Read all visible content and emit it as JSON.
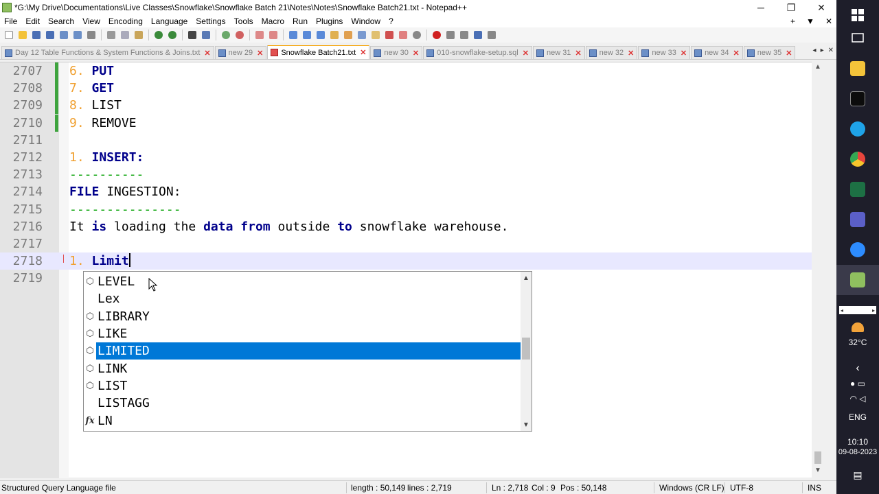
{
  "window": {
    "title": "*G:\\My Drive\\Documentations\\Live Classes\\Snowflake\\Snowflake Batch 21\\Notes\\Notes\\Snowflake Batch21.txt - Notepad++",
    "minimize": "─",
    "restore": "❐",
    "close": "✕"
  },
  "menu": {
    "items": [
      "File",
      "Edit",
      "Search",
      "View",
      "Encoding",
      "Language",
      "Settings",
      "Tools",
      "Macro",
      "Run",
      "Plugins",
      "Window",
      "?"
    ],
    "right": [
      "+",
      "▼",
      "✕"
    ]
  },
  "tabs": [
    {
      "label": "Day 12 Table Functions & System Functions & Joins.txt",
      "active": false
    },
    {
      "label": "new 29",
      "active": false
    },
    {
      "label": "Snowflake Batch21.txt",
      "active": true
    },
    {
      "label": "new 30",
      "active": false
    },
    {
      "label": "010-snowflake-setup.sql",
      "active": false
    },
    {
      "label": "new 31",
      "active": false
    },
    {
      "label": "new 32",
      "active": false
    },
    {
      "label": "new 33",
      "active": false
    },
    {
      "label": "new 34",
      "active": false
    },
    {
      "label": "new 35",
      "active": false
    }
  ],
  "tab_close_glyph": "✕",
  "tab_nav": [
    "◂",
    "▸",
    "✕"
  ],
  "editor": {
    "lines": [
      {
        "n": "2707",
        "num": "6.",
        "word": "PUT",
        "style": "kw"
      },
      {
        "n": "2708",
        "num": "7.",
        "word": "GET",
        "style": "kw"
      },
      {
        "n": "2709",
        "num": "8.",
        "word": "LIST",
        "style": "txt"
      },
      {
        "n": "2710",
        "num": "9.",
        "word": "REMOVE",
        "style": "txt"
      },
      {
        "n": "2711",
        "num": "",
        "word": "",
        "style": "txt"
      },
      {
        "n": "2712",
        "num": "1.",
        "word": "INSERT:",
        "style": "kw"
      },
      {
        "n": "2713",
        "num": "",
        "word": "----------",
        "style": "dash"
      },
      {
        "n": "2714",
        "num": "",
        "word": "FILE INGESTION:",
        "style": "mixed"
      },
      {
        "n": "2715",
        "num": "",
        "word": "---------------",
        "style": "dash"
      },
      {
        "n": "2716",
        "num": "",
        "word": "It is loading the data from outside to snowflake warehouse.",
        "style": "mixed"
      },
      {
        "n": "2717",
        "num": "",
        "word": "",
        "style": "txt"
      },
      {
        "n": "2718",
        "num": "1.",
        "word": "Limit",
        "style": "kw"
      },
      {
        "n": "2719",
        "num": "",
        "word": "",
        "style": "txt"
      }
    ],
    "line_2714": {
      "kw": "FILE",
      "rest": " INGESTION:"
    },
    "line_2716": [
      {
        "t": "It ",
        "k": false
      },
      {
        "t": "is",
        "k": true
      },
      {
        "t": " loading the ",
        "k": false
      },
      {
        "t": "data",
        "k": true
      },
      {
        "t": " ",
        "k": false
      },
      {
        "t": "from",
        "k": true
      },
      {
        "t": " outside ",
        "k": false
      },
      {
        "t": "to",
        "k": true
      },
      {
        "t": " snowflake warehouse.",
        "k": false
      }
    ]
  },
  "autocomplete": {
    "items": [
      {
        "label": "LEVEL",
        "icon": "⬡",
        "icon_name": "keyword-cube-icon"
      },
      {
        "label": "Lex",
        "icon": "",
        "icon_name": ""
      },
      {
        "label": "LIBRARY",
        "icon": "⬡",
        "icon_name": "keyword-cube-icon"
      },
      {
        "label": "LIKE",
        "icon": "⬡",
        "icon_name": "keyword-cube-icon"
      },
      {
        "label": "LIMITED",
        "icon": "⬡",
        "icon_name": "keyword-cube-icon",
        "selected": true
      },
      {
        "label": "LINK",
        "icon": "⬡",
        "icon_name": "keyword-cube-icon"
      },
      {
        "label": "LIST",
        "icon": "⬡",
        "icon_name": "keyword-cube-icon"
      },
      {
        "label": "LISTAGG",
        "icon": "",
        "icon_name": ""
      },
      {
        "label": "LN",
        "icon": "fx",
        "icon_name": "function-icon"
      }
    ],
    "scroll_up": "▲",
    "scroll_down": "▼"
  },
  "statusbar": {
    "filetype": "Structured Query Language file",
    "length": "length : 50,149",
    "lines": "lines : 2,719",
    "ln": "Ln : 2,718",
    "col": "Col : 9",
    "pos": "Pos : 50,148",
    "eol": "Windows (CR LF)",
    "encoding": "UTF-8",
    "mode": "INS"
  },
  "taskbar": {
    "temperature": "32°C",
    "language": "ENG",
    "time": "10:10",
    "date": "09-08-2023",
    "colors": {
      "windows": "#ffffff",
      "explorer": "#f3c33a",
      "terminal": "#0c0c0c",
      "edge": "#1fa3e8",
      "chrome": "#e8453c",
      "excel": "#1d7044",
      "teams": "#5b5fc7",
      "zoom": "#2d8cff",
      "notepadpp": "#8fbf5f"
    }
  },
  "colors": {
    "keyword": "#00008b",
    "number": "#f0a030",
    "selection": "#0078d7",
    "current_line": "#e8e8ff",
    "change_marker": "#3ea43e",
    "active_tab_accent": "#f6a200"
  }
}
